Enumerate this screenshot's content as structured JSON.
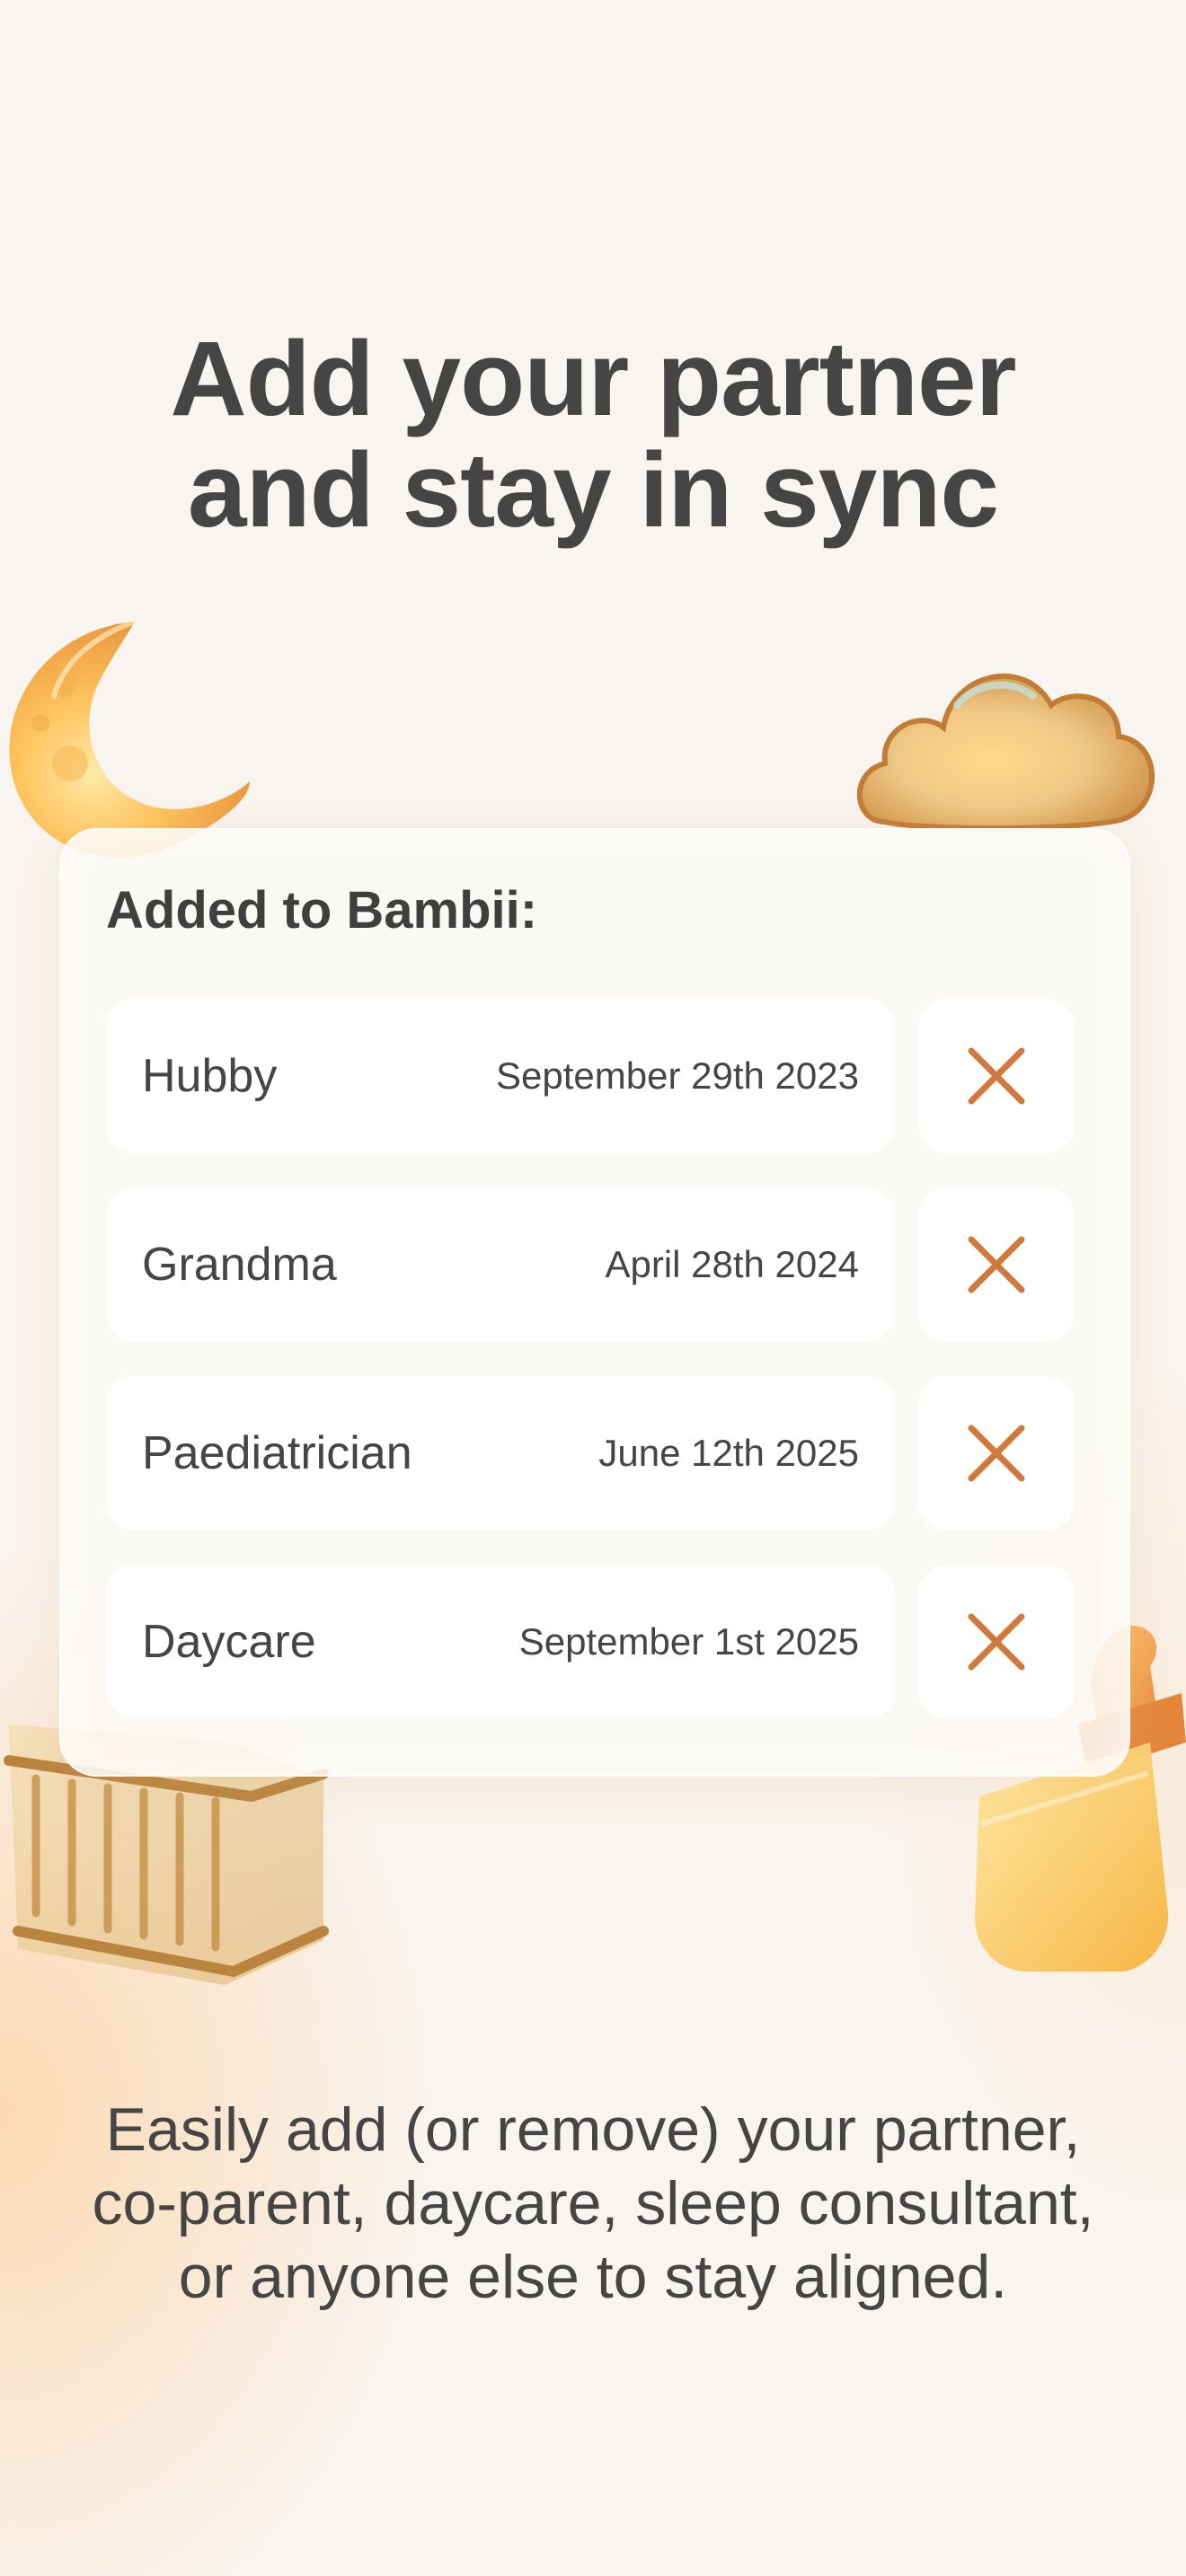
{
  "headline": {
    "line1": "Add your partner",
    "line2": "and stay in sync"
  },
  "card": {
    "title": "Added to Bambii:",
    "items": [
      {
        "name": "Hubby",
        "date": "September 29th 2023"
      },
      {
        "name": "Grandma",
        "date": "April 28th 2024"
      },
      {
        "name": "Paediatrician",
        "date": "June 12th 2025"
      },
      {
        "name": "Daycare",
        "date": "September 1st 2025"
      }
    ],
    "remove_icon": "close-icon"
  },
  "subtext": {
    "line1": "Easily add (or remove) your partner,",
    "line2": "co-parent, daycare, sleep consultant,",
    "line3": "or anyone else to stay aligned."
  },
  "decorations": [
    "moon-icon",
    "cloud-icon",
    "crib-icon",
    "baby-bottle-icon"
  ],
  "colors": {
    "background": "#f8f4ef",
    "text": "#454545",
    "accent": "#cf7a3c",
    "card": "#fcf9f5",
    "row": "#ffffff"
  }
}
